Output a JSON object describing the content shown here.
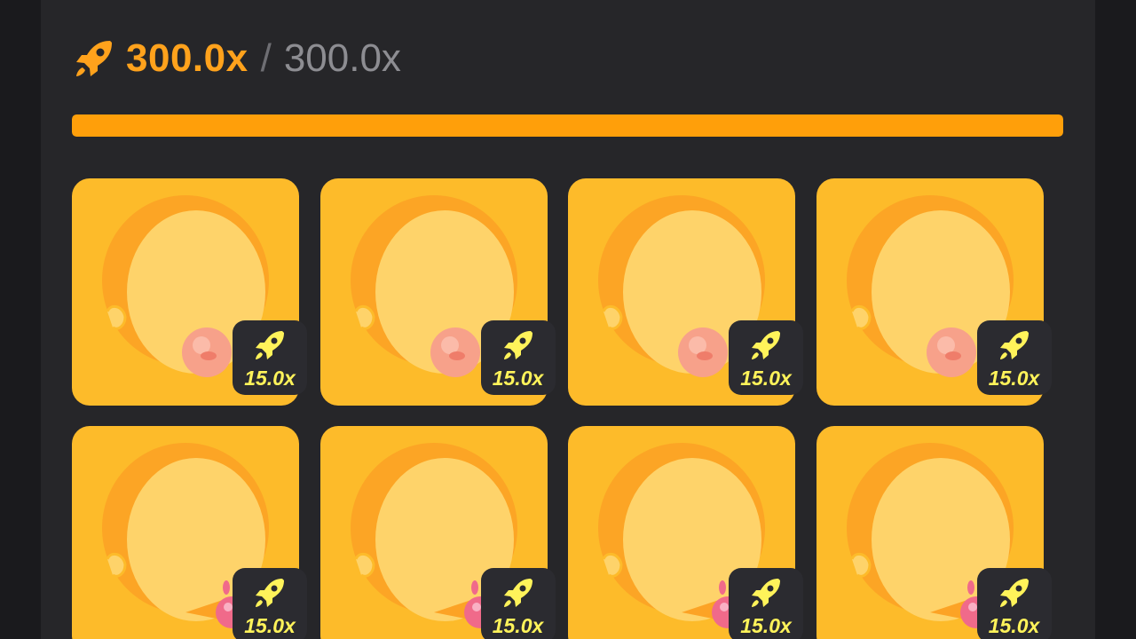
{
  "header": {
    "current_multiplier": "300.0x",
    "separator": "/",
    "max_multiplier": "300.0x",
    "progress_fraction": 1.0
  },
  "colors": {
    "accent": "#ffa21c",
    "progress": "#ff9f0a",
    "card": "#fdbb2a",
    "badge_text": "#fff35a",
    "panel": "#262629"
  },
  "cards": [
    {
      "multiplier": "15.0x",
      "icon": "bubble-gum-face"
    },
    {
      "multiplier": "15.0x",
      "icon": "bubble-gum-face"
    },
    {
      "multiplier": "15.0x",
      "icon": "bubble-gum-face"
    },
    {
      "multiplier": "15.0x",
      "icon": "bubble-gum-face"
    },
    {
      "multiplier": "15.0x",
      "icon": "ice-cream-face"
    },
    {
      "multiplier": "15.0x",
      "icon": "ice-cream-face"
    },
    {
      "multiplier": "15.0x",
      "icon": "ice-cream-face"
    },
    {
      "multiplier": "15.0x",
      "icon": "ice-cream-face"
    }
  ]
}
